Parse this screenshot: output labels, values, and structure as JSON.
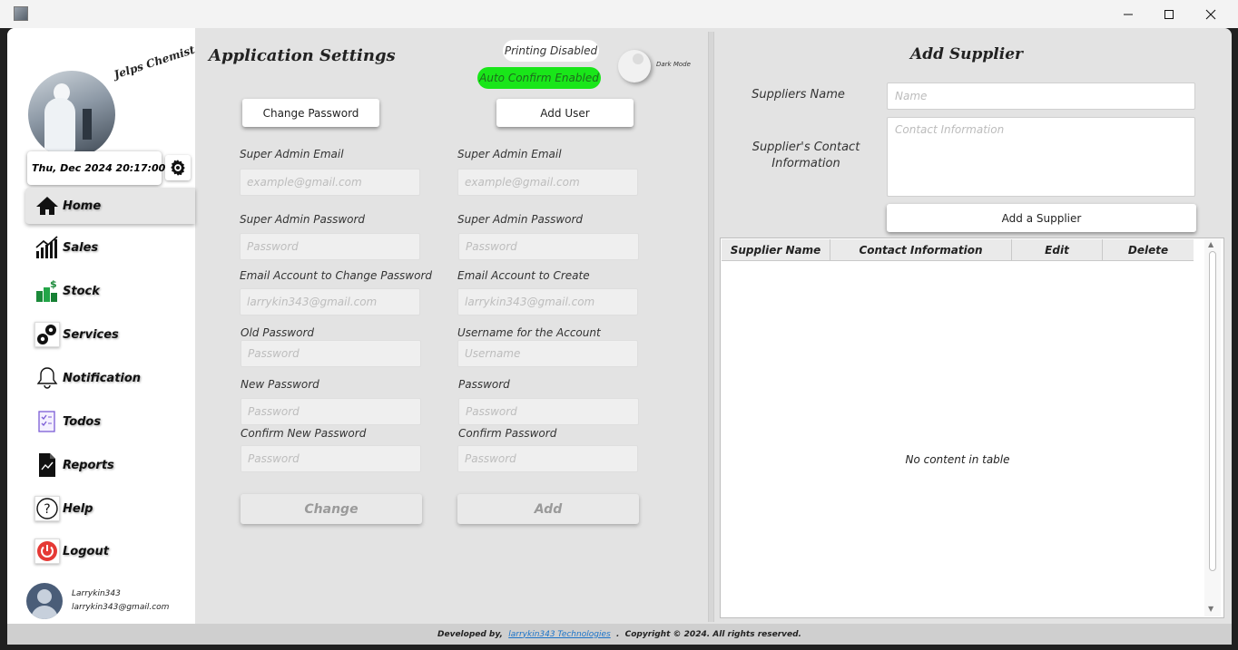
{
  "window": {
    "controls": [
      "minimize",
      "maximize",
      "close"
    ]
  },
  "sidebar": {
    "brand": "Jelps Chemist",
    "datetime": "Thu, Dec 2024 20:17:00",
    "items": [
      {
        "label": "Home",
        "icon": "home-icon",
        "active": true
      },
      {
        "label": "Sales",
        "icon": "sales-chart-icon"
      },
      {
        "label": "Stock",
        "icon": "stock-icon"
      },
      {
        "label": "Services",
        "icon": "services-gears-icon"
      },
      {
        "label": "Notification",
        "icon": "bell-icon"
      },
      {
        "label": "Todos",
        "icon": "todo-checklist-icon"
      },
      {
        "label": "Reports",
        "icon": "report-document-icon"
      },
      {
        "label": "Help",
        "icon": "help-question-icon"
      },
      {
        "label": "Logout",
        "icon": "power-icon"
      }
    ],
    "user": {
      "name": "Larrykin343",
      "email": "larrykin343@gmail.com"
    }
  },
  "settings": {
    "title": "Application Settings",
    "printing_status": "Printing Disabled",
    "auto_confirm_status": "Auto Confirm Enabled",
    "dark_mode_label": "Dark Mode",
    "change_password_button": "Change Password",
    "add_user_button": "Add User",
    "left_form": {
      "admin_email_label": "Super Admin Email",
      "admin_email_placeholder": "example@gmail.com",
      "admin_password_label": "Super Admin Password",
      "admin_password_placeholder": "Password",
      "target_email_label": "Email Account to Change Password",
      "target_email_placeholder": "larrykin343@gmail.com",
      "old_password_label": "Old Password",
      "old_password_placeholder": "Password",
      "new_password_label": "New Password",
      "new_password_placeholder": "Password",
      "confirm_password_label": "Confirm New Password",
      "confirm_password_placeholder": "Password",
      "submit_label": "Change"
    },
    "right_form": {
      "admin_email_label": "Super Admin Email",
      "admin_email_placeholder": "example@gmail.com",
      "admin_password_label": "Super Admin Password",
      "admin_password_placeholder": "Password",
      "new_email_label": "Email Account to Create",
      "new_email_placeholder": "larrykin343@gmail.com",
      "username_label": "Username for the Account",
      "username_placeholder": "Username",
      "password_label": "Password",
      "password_placeholder": "Password",
      "confirm_password_label": "Confirm Password",
      "confirm_password_placeholder": "Password",
      "submit_label": "Add"
    }
  },
  "supplier": {
    "title": "Add Supplier",
    "name_label": "Suppliers Name",
    "name_placeholder": "Name",
    "contact_label_line1": "Supplier's Contact",
    "contact_label_line2": "Information",
    "contact_placeholder": "Contact Information",
    "add_button": "Add a Supplier",
    "table": {
      "columns": [
        "Supplier Name",
        "Contact Information",
        "Edit",
        "Delete"
      ],
      "rows": [],
      "empty_text": "No content in table"
    }
  },
  "footer": {
    "prefix": "Developed by,  ",
    "link": "larrykin343 Technologies",
    "suffix": "  .  Copyright © 2024. All rights reserved."
  },
  "colors": {
    "auto_confirm_bg": "#19e619",
    "logout_red": "#e53935",
    "link_blue": "#1a73c9"
  }
}
